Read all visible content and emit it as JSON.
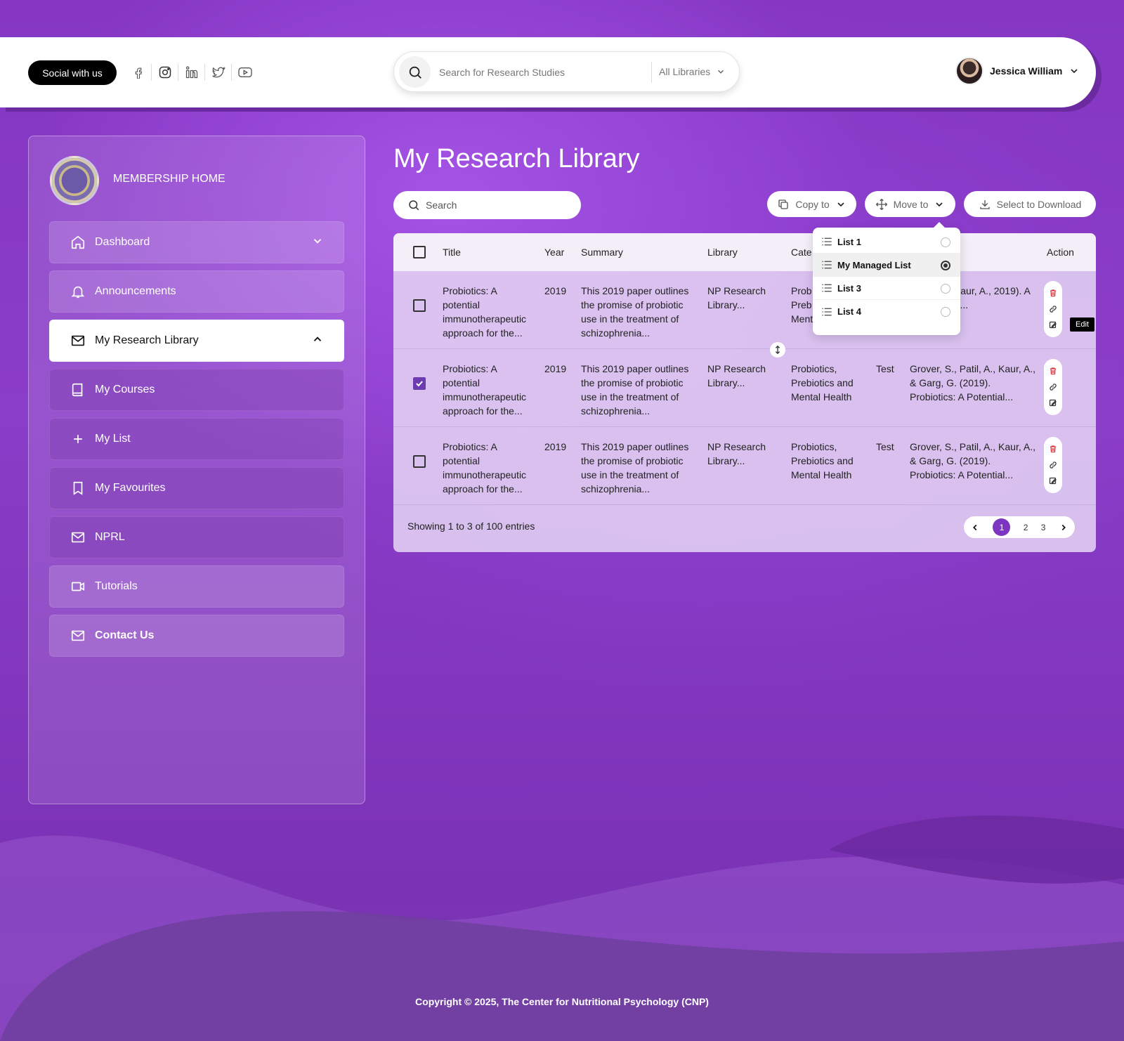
{
  "header": {
    "social_label": "Social with us",
    "social_icons": [
      "facebook-icon",
      "instagram-icon",
      "linkedin-icon",
      "twitter-icon",
      "youtube-icon"
    ],
    "search_placeholder": "Search for Research Studies",
    "library_select": "All Libraries",
    "user_name": "Jessica William"
  },
  "sidebar": {
    "home_label": "MEMBERSHIP HOME",
    "items": [
      {
        "label": "Dashboard",
        "icon": "home-icon"
      },
      {
        "label": "Announcements",
        "icon": "bell-icon"
      },
      {
        "label": "My Research Library",
        "icon": "mail-icon"
      },
      {
        "label": "My Courses",
        "icon": "book-icon"
      },
      {
        "label": "My List",
        "icon": "plus-icon"
      },
      {
        "label": "My Favourites",
        "icon": "bookmark-icon"
      },
      {
        "label": "NPRL",
        "icon": "mail-icon"
      },
      {
        "label": "Tutorials",
        "icon": "video-icon"
      },
      {
        "label": "Contact Us",
        "icon": "mail-icon"
      }
    ]
  },
  "main": {
    "title": "My Research Library",
    "search_placeholder": "Search",
    "copy_label": "Copy to",
    "move_label": "Move to",
    "download_label": "Select to Download",
    "columns": [
      "Title",
      "Year",
      "Summary",
      "Library",
      "Cate",
      "Action"
    ],
    "rows": [
      {
        "checked": false,
        "title": "Probiotics: A potential immunotherapeutic approach for the...",
        "year": "2019",
        "summary": "This 2019 paper outlines the promise of probiotic use in the treatment of schizophrenia...",
        "library": "NP Research Library...",
        "category": "Prob Preb Ment",
        "extra": "",
        "citation": "atil, A., Kaur, A., 2019). A Potential..."
      },
      {
        "checked": true,
        "title": "Probiotics: A potential immunotherapeutic approach for the...",
        "year": "2019",
        "summary": "This 2019 paper outlines the promise of probiotic use in the treatment of schizophrenia...",
        "library": "NP Research Library...",
        "category": "Probiotics, Prebiotics and Mental Health",
        "extra": "Test",
        "citation": "Grover, S., Patil, A., Kaur, A., & Garg, G. (2019). Probiotics: A Potential..."
      },
      {
        "checked": false,
        "title": "Probiotics: A potential immunotherapeutic approach for the...",
        "year": "2019",
        "summary": "This 2019 paper outlines the promise of probiotic use in the treatment of schizophrenia...",
        "library": "NP Research Library...",
        "category": "Probiotics, Prebiotics and Mental Health",
        "extra": "Test",
        "citation": "Grover, S., Patil, A., Kaur, A., & Garg, G. (2019). Probiotics: A Potential..."
      }
    ],
    "entries_text": "Showing 1 to 3 of 100 entries",
    "pages": [
      "1",
      "2",
      "3"
    ],
    "current_page": "1",
    "tooltip": "Edit"
  },
  "dropdown": {
    "items": [
      {
        "label": "List 1",
        "selected": false
      },
      {
        "label": "My Managed List",
        "selected": true
      },
      {
        "label": "List 3",
        "selected": false
      },
      {
        "label": "List 4",
        "selected": false
      }
    ]
  },
  "footer": {
    "copyright": "Copyright © 2025, The Center for Nutritional Psychology (CNP)"
  },
  "colors": {
    "accent": "#7b35c0",
    "background": "#8134bd",
    "danger": "#d9363e"
  }
}
